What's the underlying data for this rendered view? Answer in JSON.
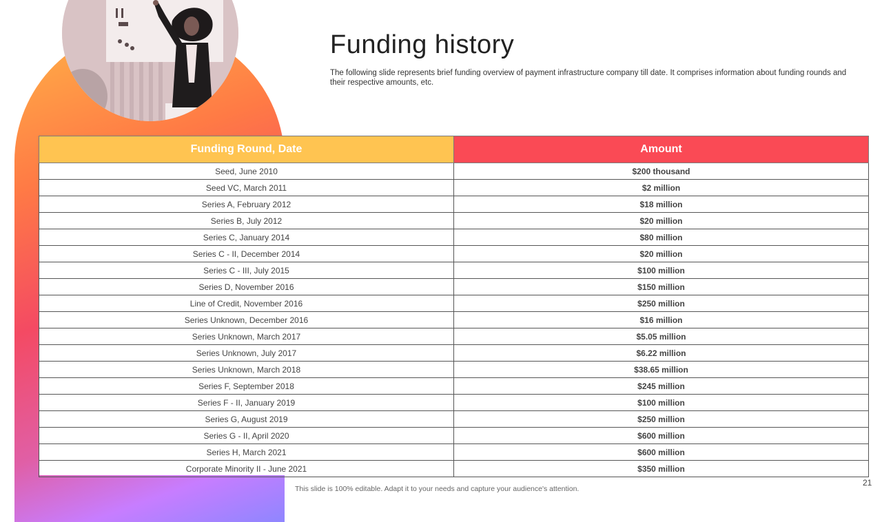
{
  "slide": {
    "title": "Funding history",
    "subtitle": "The following slide represents brief funding overview of payment infrastructure company till date. It comprises information about funding rounds and their respective amounts, etc.",
    "footer_note": "This slide is 100% editable. Adapt it to your needs and capture your audience's attention.",
    "page_number": "21"
  },
  "table": {
    "headers": [
      "Funding  Round, Date",
      "Amount"
    ],
    "rows": [
      [
        "Seed, June 2010",
        "$200 thousand"
      ],
      [
        "Seed VC,  March 2011",
        "$2 million"
      ],
      [
        "Series A, February 2012",
        "$18 million"
      ],
      [
        "Series B, July 2012",
        "$20 million"
      ],
      [
        "Series C, January 2014",
        "$80 million"
      ],
      [
        "Series C - II, December 2014",
        "$20 million"
      ],
      [
        "Series C - III, July 2015",
        "$100 million"
      ],
      [
        "Series D, November 2016",
        "$150 million"
      ],
      [
        "Line of Credit, November 2016",
        "$250 million"
      ],
      [
        "Series Unknown, December 2016",
        "$16 million"
      ],
      [
        "Series Unknown, March 2017",
        "$5.05 million"
      ],
      [
        "Series Unknown, July 2017",
        "$6.22 million"
      ],
      [
        "Series Unknown, March 2018",
        "$38.65 million"
      ],
      [
        "Series F, September 2018",
        "$245 million"
      ],
      [
        "Series F - II,  January 2019",
        "$100 million"
      ],
      [
        "Series G, August 2019",
        "$250 million"
      ],
      [
        "Series G - II,  April 2020",
        "$600 million"
      ],
      [
        "Series H, March 2021",
        "$600 million"
      ],
      [
        "Corporate Minority II - June 2021",
        "$350 million"
      ]
    ]
  },
  "colors": {
    "header_round": "#ffc451",
    "header_amount": "#fa4a55",
    "accent_gradient": [
      "#ffb347",
      "#f44a63",
      "#c77dff",
      "#8f86ff"
    ]
  }
}
